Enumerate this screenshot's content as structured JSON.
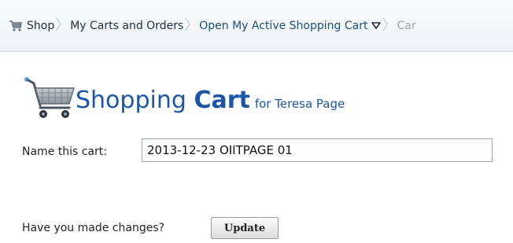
{
  "breadcrumb": {
    "items": [
      {
        "label": "Shop",
        "icon": "shopping-cart-icon"
      },
      {
        "label": "My Carts and Orders"
      },
      {
        "label": "Open My Active Shopping Cart",
        "icon": "caret-down-icon"
      },
      {
        "label": "Car"
      }
    ]
  },
  "header": {
    "title_part1": "Shopping",
    "title_part2": "Cart",
    "for_user": "for Teresa Page",
    "icon": "shopping-cart-icon"
  },
  "form": {
    "name_label": "Name this cart:",
    "name_value": "2013-12-23 OIITPAGE 01",
    "changes_label": "Have you made changes?",
    "update_label": "Update"
  },
  "colors": {
    "accent": "#1b56a8",
    "link": "#1b4f80"
  }
}
